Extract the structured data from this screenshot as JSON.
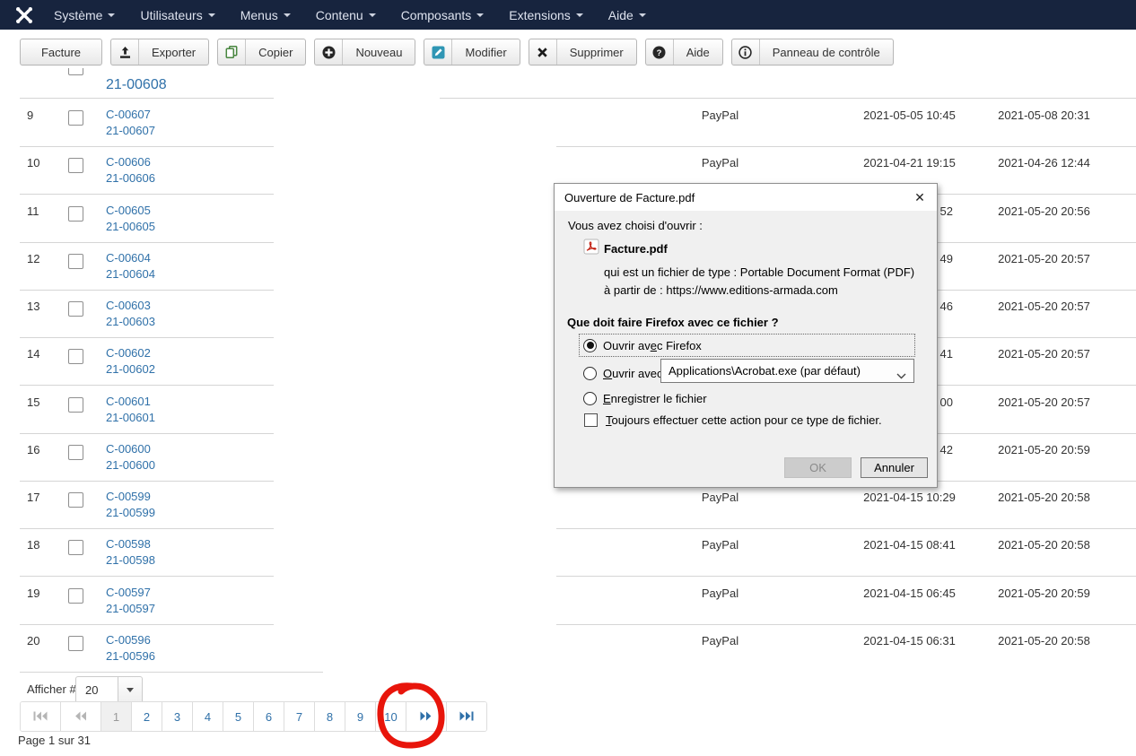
{
  "colors": {
    "menubar_bg": "#17243e",
    "link_blue": "#3071a9",
    "edit_icon_teal": "#2f96b4",
    "copy_icon_green": "#48863f",
    "annotation_red": "#e8150b"
  },
  "menubar": {
    "items": [
      {
        "label": "Système"
      },
      {
        "label": "Utilisateurs"
      },
      {
        "label": "Menus"
      },
      {
        "label": "Contenu"
      },
      {
        "label": "Composants"
      },
      {
        "label": "Extensions"
      },
      {
        "label": "Aide"
      }
    ]
  },
  "toolbar": {
    "buttons": [
      {
        "label": "Facture",
        "icon": ""
      },
      {
        "label": "Exporter",
        "icon": "export"
      },
      {
        "label": "Copier",
        "icon": "copy"
      },
      {
        "label": "Nouveau",
        "icon": "plus-circle"
      },
      {
        "label": "Modifier",
        "icon": "edit"
      },
      {
        "label": "Supprimer",
        "icon": "delete"
      },
      {
        "label": "Aide",
        "icon": "help"
      },
      {
        "label": "Panneau de contrôle",
        "icon": "info-circle"
      }
    ]
  },
  "table": {
    "partial_row": {
      "invoice_line2": "21-00608"
    },
    "rows": [
      {
        "num": "9",
        "invoice": "C-00607",
        "invoice2": "21-00607",
        "payment": "PayPal",
        "date1": "2021-05-05 10:45",
        "date2": "2021-05-08 20:31"
      },
      {
        "num": "10",
        "invoice": "C-00606",
        "invoice2": "21-00606",
        "payment": "PayPal",
        "date1": "2021-04-21 19:15",
        "date2": "2021-04-26 12:44"
      },
      {
        "num": "11",
        "invoice": "C-00605",
        "invoice2": "21-00605",
        "date1_fragment": "52",
        "date2": "2021-05-20 20:56"
      },
      {
        "num": "12",
        "invoice": "C-00604",
        "invoice2": "21-00604",
        "date1_fragment": "49",
        "date2": "2021-05-20 20:57"
      },
      {
        "num": "13",
        "invoice": "C-00603",
        "invoice2": "21-00603",
        "date1_fragment": "46",
        "date2": "2021-05-20 20:57"
      },
      {
        "num": "14",
        "invoice": "C-00602",
        "invoice2": "21-00602",
        "date1_fragment": "41",
        "date2": "2021-05-20 20:57"
      },
      {
        "num": "15",
        "invoice": "C-00601",
        "invoice2": "21-00601",
        "date1_fragment": "00",
        "date2": "2021-05-20 20:57"
      },
      {
        "num": "16",
        "invoice": "C-00600",
        "invoice2": "21-00600",
        "date1_fragment": "42",
        "date2": "2021-05-20 20:59"
      },
      {
        "num": "17",
        "invoice": "C-00599",
        "invoice2": "21-00599",
        "payment": "PayPal",
        "date1": "2021-04-15 10:29",
        "date2": "2021-05-20 20:58"
      },
      {
        "num": "18",
        "invoice": "C-00598",
        "invoice2": "21-00598",
        "payment": "PayPal",
        "date1": "2021-04-15 08:41",
        "date2": "2021-05-20 20:58"
      },
      {
        "num": "19",
        "invoice": "C-00597",
        "invoice2": "21-00597",
        "payment": "PayPal",
        "date1": "2021-04-15 06:45",
        "date2": "2021-05-20 20:59"
      },
      {
        "num": "20",
        "invoice": "C-00596",
        "invoice2": "21-00596",
        "payment": "PayPal",
        "date1": "2021-04-15 06:31",
        "date2": "2021-05-20 20:58"
      }
    ]
  },
  "dialog": {
    "title": "Ouverture de Facture.pdf",
    "close_glyph": "✕",
    "intro": "Vous avez choisi d'ouvrir :",
    "filename": "Facture.pdf",
    "type_label": "qui est un fichier de type :",
    "type_value": "Portable Document Format (PDF)",
    "from_label": "à partir de :",
    "from_value": "https://www.editions-armada.com",
    "question": "Que doit faire Firefox avec ce fichier ?",
    "options": [
      {
        "text": "Ouvrir avec Firefox",
        "u": 9,
        "selected": true
      },
      {
        "text": "Ouvrir avec",
        "u": 0,
        "selected": false,
        "dropdown": "Applications\\Acrobat.exe (par défaut)"
      },
      {
        "text": "Enregistrer le fichier",
        "u": 0,
        "selected": false
      }
    ],
    "always_checkbox": {
      "text": "Toujours effectuer cette action pour ce type de fichier.",
      "u": 0,
      "checked": false
    },
    "ok_label": "OK",
    "cancel_label": "Annuler"
  },
  "pagination": {
    "display_label": "Afficher #",
    "display_value": "20",
    "pages": [
      "1",
      "2",
      "3",
      "4",
      "5",
      "6",
      "7",
      "8",
      "9",
      "10"
    ],
    "active_page": "1",
    "page_counter": "Page 1 sur 31"
  }
}
